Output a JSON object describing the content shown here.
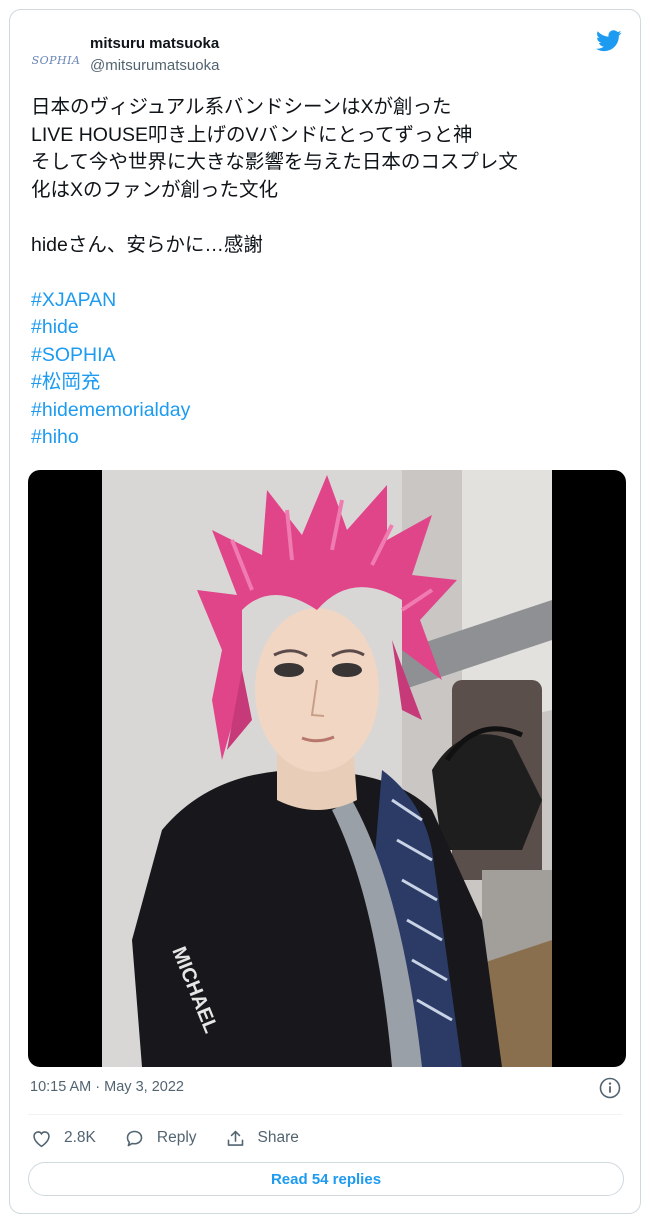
{
  "tweet": {
    "avatar_text": "SOPHIA",
    "display_name": "mitsuru matsuoka",
    "handle": "@mitsurumatsuoka",
    "lines": [
      "日本のヴィジュアル系バンドシーンはXが創った",
      "LIVE HOUSE叩き上げのVバンドにとってずっと神",
      "そして今や世界に大きな影響を与えた日本のコスプレ文",
      "化はXのファンが創った文化"
    ],
    "line2": "hideさん、安らかに…感謝",
    "hashtags": [
      "#XJAPAN",
      "#hide",
      "#SOPHIA",
      "#松岡充",
      "#hidememorialday",
      "#hiho"
    ],
    "timestamp": "10:15 AM · May 3, 2022"
  },
  "actions": {
    "like_count": "2.8K",
    "reply_label": "Reply",
    "share_label": "Share",
    "read_replies_label": "Read 54 replies"
  },
  "colors": {
    "accent": "#1d9bf0",
    "secondary_text": "#536471",
    "hair": "#e0458a"
  }
}
